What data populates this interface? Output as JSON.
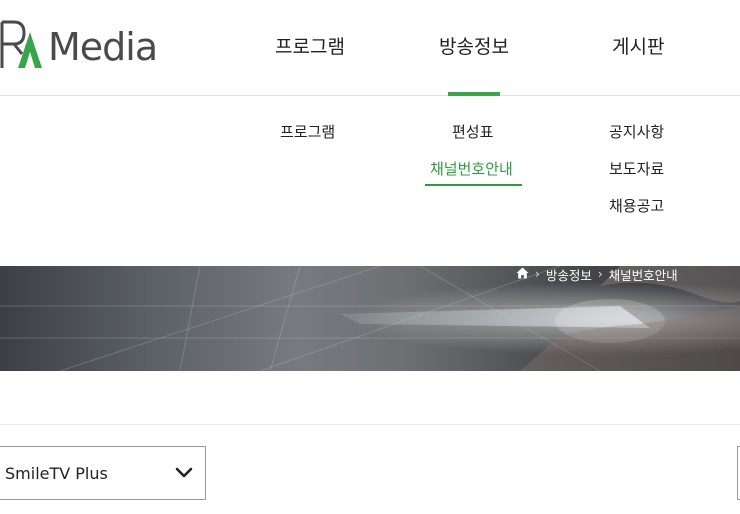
{
  "logo": {
    "text": "Media",
    "mark": "RA",
    "accent": "#3aa44a"
  },
  "gnb": {
    "items": [
      {
        "label": "프로그램"
      },
      {
        "label": "방송정보",
        "active": true
      },
      {
        "label": "게시판"
      }
    ]
  },
  "submenu": {
    "program": [
      {
        "label": "프로그램"
      }
    ],
    "broadcast": [
      {
        "label": "편성표"
      },
      {
        "label": "채널번호안내",
        "active": true
      }
    ],
    "board": [
      {
        "label": "공지사항"
      },
      {
        "label": "보도자료"
      },
      {
        "label": "채용공고"
      }
    ]
  },
  "breadcrumb": {
    "home_icon": "home-icon",
    "items": [
      {
        "label": "방송정보"
      },
      {
        "label": "채널번호안내"
      }
    ]
  },
  "channel_select": {
    "value": "SmileTV Plus",
    "icon": "chevron-down-icon"
  },
  "colors": {
    "accent": "#3aa44a",
    "active_text": "#2f9b3f",
    "text": "#222222",
    "border": "#9a9a9a"
  }
}
